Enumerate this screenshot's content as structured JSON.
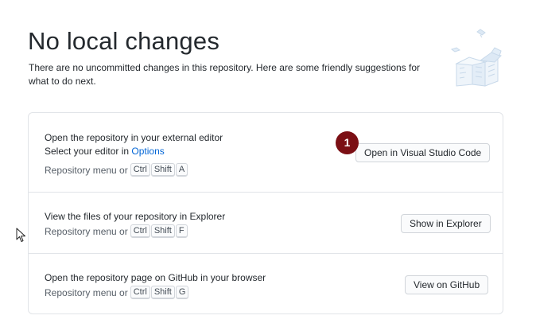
{
  "header": {
    "title": "No local changes",
    "subtitle": "There are no uncommitted changes in this repository. Here are some friendly suggestions for what to do next."
  },
  "actions": [
    {
      "title": "Open the repository in your external editor",
      "description_prefix": "Select your editor in ",
      "description_link": "Options",
      "shortcut_prefix": "Repository menu or",
      "keys": [
        "Ctrl",
        "Shift",
        "A"
      ],
      "button_label": "Open in Visual Studio Code"
    },
    {
      "title": "View the files of your repository in Explorer",
      "shortcut_prefix": "Repository menu or",
      "keys": [
        "Ctrl",
        "Shift",
        "F"
      ],
      "button_label": "Show in Explorer"
    },
    {
      "title": "Open the repository page on GitHub in your browser",
      "shortcut_prefix": "Repository menu or",
      "keys": [
        "Ctrl",
        "Shift",
        "G"
      ],
      "button_label": "View on GitHub"
    }
  ],
  "step_badge": "1",
  "colors": {
    "link": "#0366d6",
    "badge": "#7b0f14",
    "border": "#e1e4e8"
  },
  "icons": {
    "illustration": "empty-boxes-illustration",
    "cursor": "mouse-pointer-icon"
  }
}
